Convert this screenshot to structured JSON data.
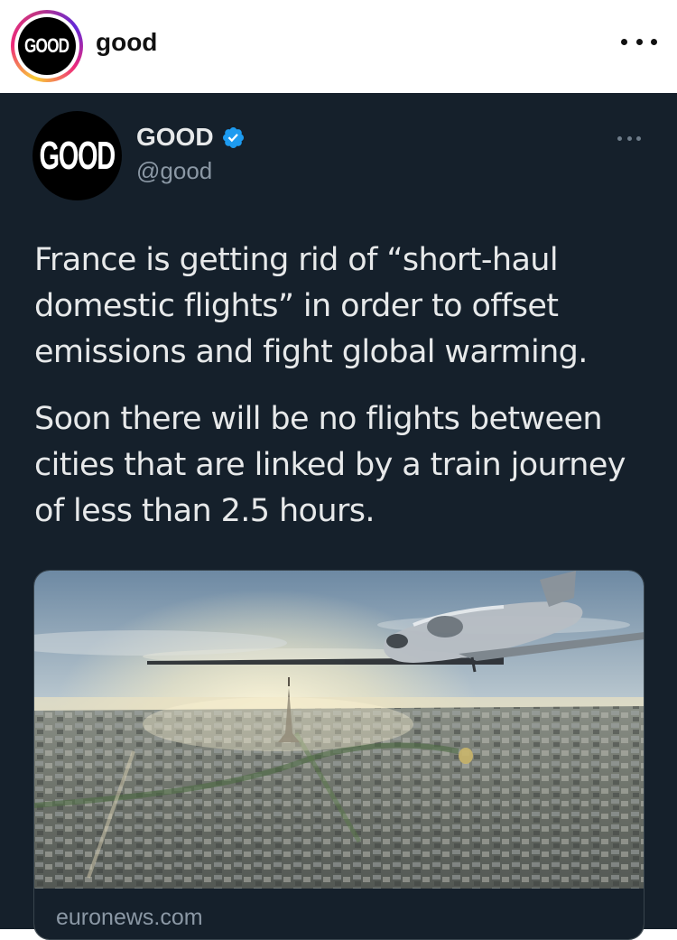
{
  "instagram": {
    "avatar_text": "GOOD",
    "username": "good",
    "more_icon": "more-horizontal-icon"
  },
  "tweet": {
    "avatar_text": "GOOD",
    "name": "GOOD",
    "verified_icon": "verified-badge-icon",
    "handle": "@good",
    "more_icon": "more-horizontal-icon",
    "paragraphs": [
      "France is getting rid of “short-haul domestic flights” in order to offset emissions and fight global warming.",
      "Soon there will be no flights between cities that are linked by a train journey of less than 2.5 hours."
    ],
    "link_card": {
      "image": "airplane flying over Paris with Eiffel Tower at sunset",
      "domain": "euronews.com"
    }
  },
  "colors": {
    "tweet_background": "#15202b",
    "text_primary": "#e7e9ea",
    "text_secondary": "#8b98a5",
    "verified_blue": "#1d9bf0"
  }
}
